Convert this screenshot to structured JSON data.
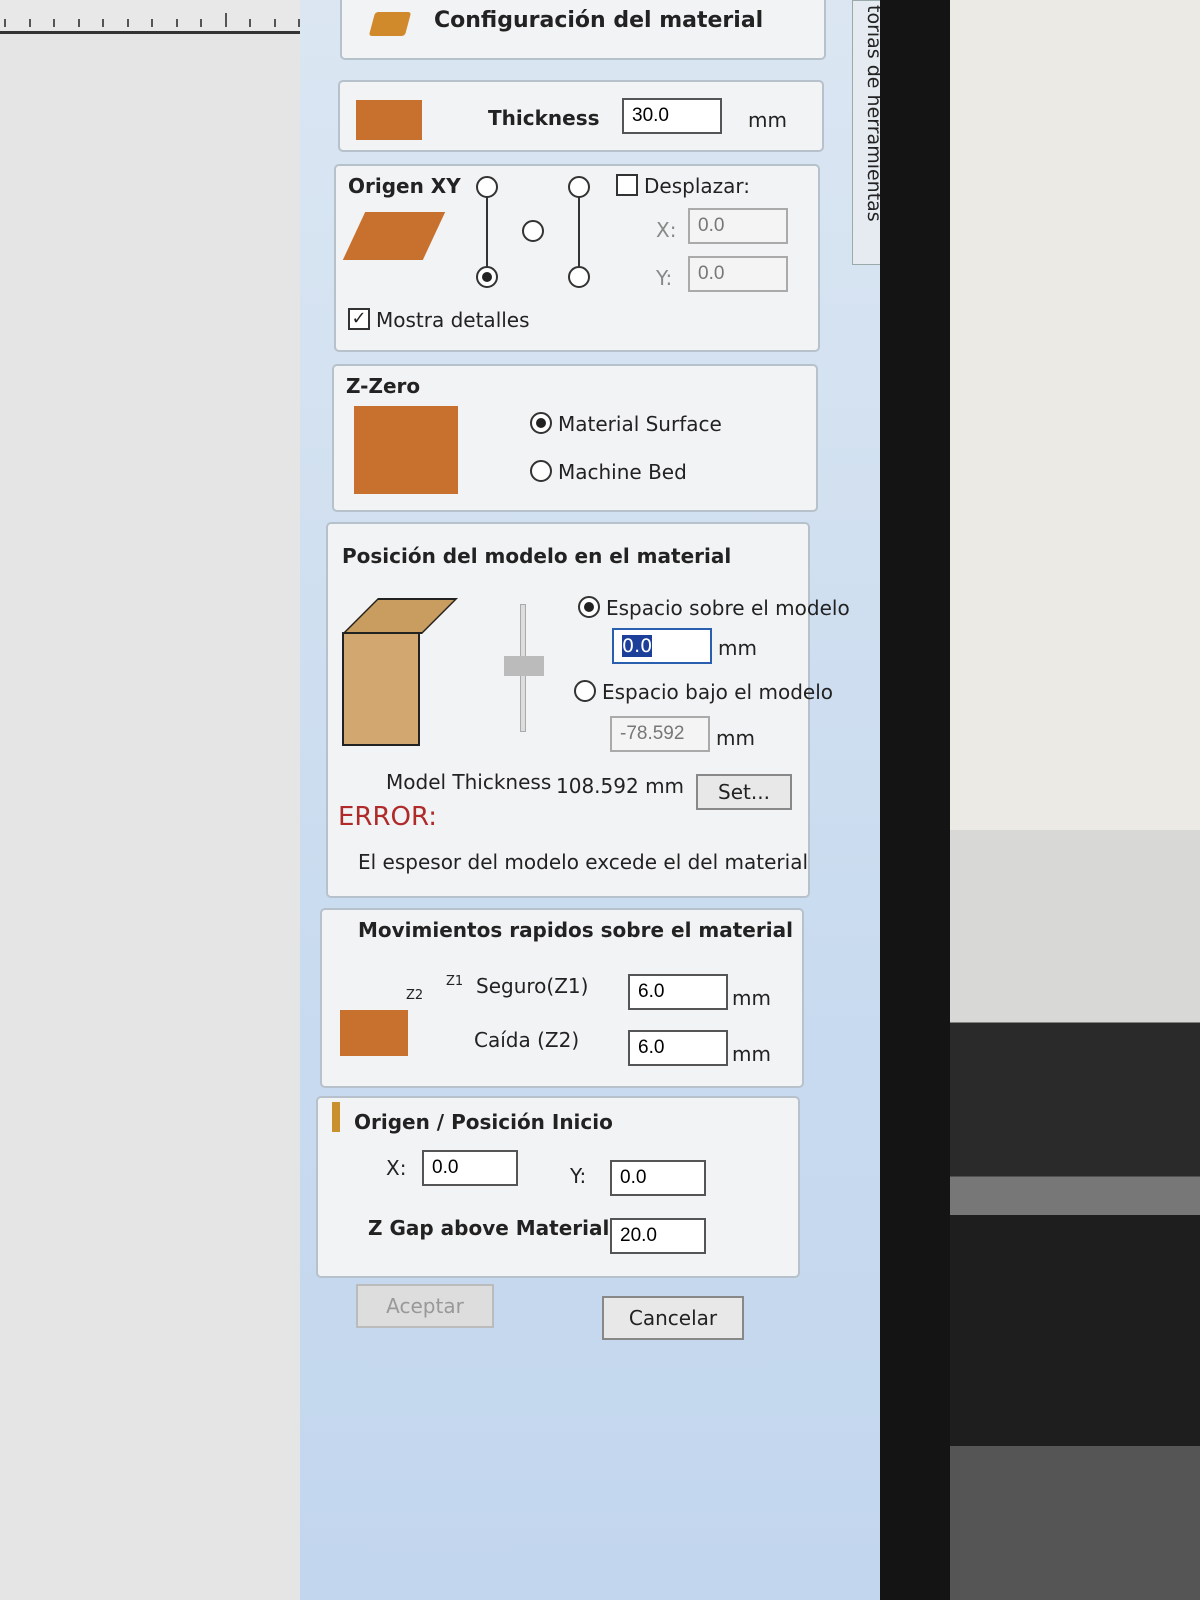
{
  "header": {
    "title": "Configuración del material"
  },
  "side_tab": {
    "label": "torias de herramientas"
  },
  "thickness": {
    "label": "Thickness",
    "value": "30.0",
    "unit": "mm"
  },
  "origin_xy": {
    "title": "Origen XY",
    "offset_label": "Desplazar:",
    "x_label": "X:",
    "x_value": "0.0",
    "y_label": "Y:",
    "y_value": "0.0",
    "show_details": "Mostra detalles",
    "show_details_checked": true,
    "offset_checked": false
  },
  "z_zero": {
    "title": "Z-Zero",
    "option_surface": "Material Surface",
    "option_bed": "Machine Bed",
    "selected": "Material Surface"
  },
  "model_position": {
    "title": "Posición del modelo en el material",
    "above_label": "Espacio sobre el modelo",
    "above_value": "0.0",
    "above_unit": "mm",
    "below_label": "Espacio bajo el modelo",
    "below_value": "-78.592",
    "below_unit": "mm",
    "thickness_label": "Model Thickness",
    "thickness_value": "108.592 mm",
    "set_button": "Set...",
    "error_title": "ERROR:",
    "error_message": "El espesor del modelo excede el del material"
  },
  "rapid_moves": {
    "title": "Movimientos rapidos sobre el material",
    "z1_tag": "Z1",
    "z2_tag": "Z2",
    "safe_label": "Seguro(Z1)",
    "safe_value": "6.0",
    "safe_unit": "mm",
    "drop_label": "Caída (Z2)",
    "drop_value": "6.0",
    "drop_unit": "mm"
  },
  "home": {
    "title": "Origen / Posición Inicio",
    "x_label": "X:",
    "x_value": "0.0",
    "y_label": "Y:",
    "y_value": "0.0",
    "zgap_label": "Z Gap above Material",
    "zgap_value": "20.0"
  },
  "buttons": {
    "accept": "Aceptar",
    "cancel": "Cancelar"
  },
  "colors": {
    "material": "#c8702e",
    "error": "#b02a2a",
    "selection": "#1c3f9a"
  }
}
